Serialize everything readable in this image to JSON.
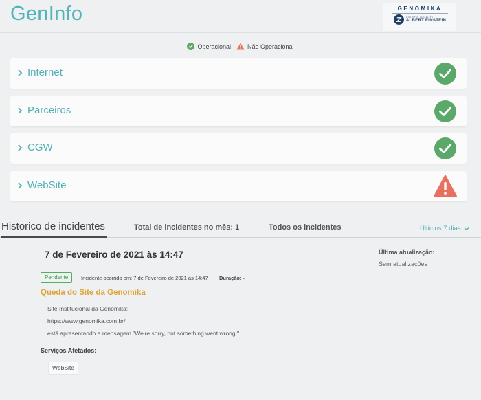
{
  "header": {
    "title": "GenInfo"
  },
  "logo": {
    "brand": "GENOMIKA",
    "subtitle_small": "HOSPITAL ISRAELITA",
    "subtitle": "ALBERT EINSTEIN"
  },
  "legend": {
    "operational": "Operacional",
    "not_operational": "Não Operacional"
  },
  "services": [
    {
      "name": "Internet",
      "status": "operational"
    },
    {
      "name": "Parceiros",
      "status": "operational"
    },
    {
      "name": "CGW",
      "status": "operational"
    },
    {
      "name": "WebSite",
      "status": "not_operational"
    }
  ],
  "tabs": {
    "history": "Historico de incidentes",
    "total": "Total de incidentes no mês: 1",
    "all": "Todos os incidentes",
    "period": "Últimos 7 dias"
  },
  "incident": {
    "date": "7 de Fevereiro de 2021 às 14:47",
    "last_update_label": "Última atualização:",
    "last_update_value": "Sem atualizações",
    "badge": "Pendente",
    "occurred": "Incidente ocorrido em: 7 de Fevereiro de 2021 às 14:47",
    "duration": "Duração: -",
    "title": "Queda do Site da Genomika",
    "description": [
      "Site Institucional da Genomika:",
      "https://www.genomika.com.br/",
      "está apresentando a mensagem \"We're sorry, but something went wrong.\""
    ],
    "affected_label": "Serviços Afetados:",
    "affected_services": [
      "WebSite"
    ]
  },
  "colors": {
    "accent": "#52b3b8",
    "operational": "#5aa86a",
    "not_operational": "#e8705f",
    "incident_title": "#e0a53a"
  }
}
